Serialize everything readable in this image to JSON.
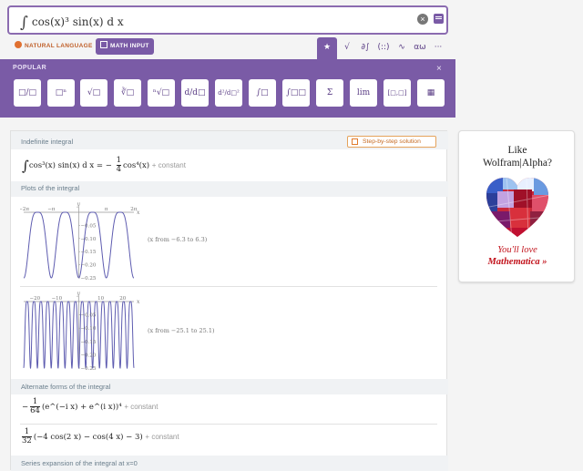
{
  "search": {
    "query": "cos(x)³ sin(x) d x",
    "integral_symbol": "∫"
  },
  "modes": {
    "natural_language": "NATURAL LANGUAGE",
    "math_input": "MATH INPUT"
  },
  "palette_tabs": [
    "★",
    "√",
    "∂∫",
    "(::)",
    "∿",
    "αω",
    "···"
  ],
  "palette": {
    "title": "POPULAR",
    "close": "×",
    "buttons": [
      "□/□",
      "□ⁿ",
      "√□",
      "∛□",
      "ⁿ√□",
      "d/d□",
      "d²/d□²",
      "∫□",
      "∫□□",
      "Σ",
      "lim",
      "[□,□]",
      "▦"
    ]
  },
  "pods": {
    "indefinite": {
      "title": "Indefinite integral",
      "step_button": "Step-by-step solution",
      "lhs": "cos³(x) sin(x) d x = −",
      "frac_num": "1",
      "frac_den": "4",
      "rhs": "cos⁴(x)",
      "constant": "+ constant"
    },
    "plots": {
      "title": "Plots of the integral",
      "range1": "(x from −6.3 to 6.3)",
      "range2": "(x from −25.1 to 25.1)"
    },
    "alternate": {
      "title": "Alternate forms of the integral",
      "f1_num": "1",
      "f1_den": "64",
      "f1_body": "(e^(−i x) + e^(i x))⁴",
      "f2_num": "1",
      "f2_den": "32",
      "f2_body": "(−4 cos(2 x) − cos(4 x) − 3)",
      "constant": "+ constant"
    },
    "series": {
      "title": "Series expansion of the integral at x=0"
    }
  },
  "ad": {
    "line1": "Like",
    "line2": "Wolfram|Alpha?",
    "cta1": "You'll love",
    "cta2": "Mathematica »"
  },
  "chart_data": [
    {
      "type": "line",
      "function": "-cos(x)^4/4",
      "xlim": [
        -6.3,
        6.3
      ],
      "ylim": [
        -0.25,
        0
      ],
      "xticks": [
        "−2π",
        "−π",
        "π",
        "2π"
      ],
      "yticks": [
        "−0.05",
        "−0.10",
        "−0.15",
        "−0.20",
        "−0.25"
      ],
      "xlabel": "x",
      "ylabel": "y"
    },
    {
      "type": "line",
      "function": "-cos(x)^4/4",
      "xlim": [
        -25.1,
        25.1
      ],
      "ylim": [
        -0.25,
        0
      ],
      "xticks": [
        "−20",
        "−10",
        "10",
        "20"
      ],
      "yticks": [
        "−0.05",
        "−0.10",
        "−0.15",
        "−0.20",
        "−0.25"
      ],
      "xlabel": "x",
      "ylabel": "y"
    }
  ],
  "colors": {
    "accent": "#7a5ba6",
    "plot_line": "#5e5cb0",
    "orange": "#e07a2b",
    "ad_red": "#c2121b"
  }
}
